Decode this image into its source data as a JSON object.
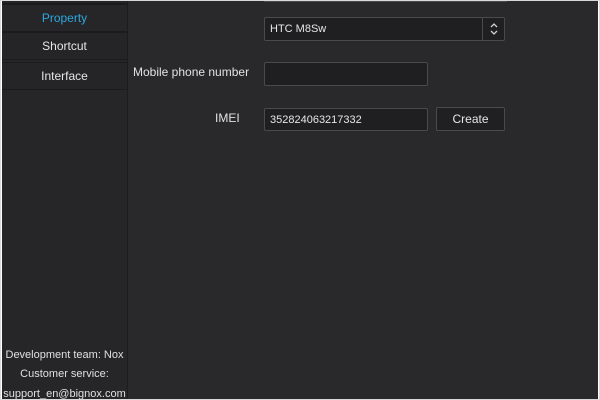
{
  "sidebar": {
    "items": [
      {
        "label": "Property",
        "active": true
      },
      {
        "label": "Shortcut",
        "active": false
      },
      {
        "label": "Interface",
        "active": false
      }
    ],
    "footer": {
      "line1": "Development team: Nox",
      "line2": "Customer service:",
      "line3": "support_en@bignox.com"
    }
  },
  "main": {
    "model_select": {
      "value": "HTC M8Sw",
      "icon": "chevron-updown-icon"
    },
    "phone": {
      "label": "Mobile phone number",
      "value": ""
    },
    "imei": {
      "label": "IMEI",
      "value": "352824063217332",
      "create_label": "Create"
    }
  },
  "colors": {
    "background": "#29292b",
    "sidebar": "#262628",
    "accent": "#2aa8e0",
    "text": "#e6e6e6"
  }
}
